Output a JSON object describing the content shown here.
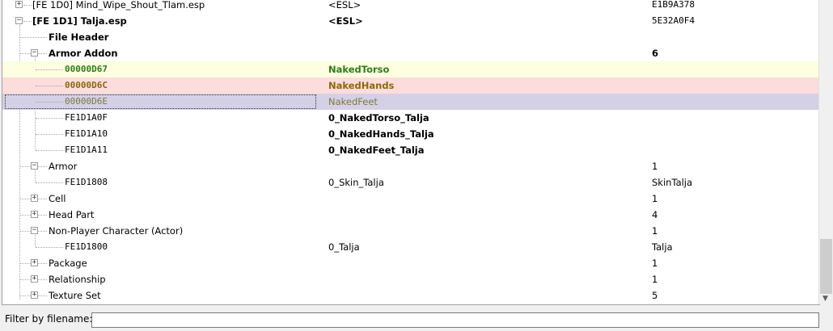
{
  "tree": {
    "rows": [
      {
        "name": "Mind_Wipe_Shout_Tlam.esp",
        "c1": "[FE 1D0] Mind_Wipe_Shout_Tlam.esp",
        "c2": "<ESL>",
        "c3": "E1B9A378"
      },
      {
        "name": "Talja.esp",
        "c1": "[FE 1D1] Talja.esp",
        "c2": "<ESL>",
        "c3": "5E32A0F4"
      },
      {
        "name": "File Header",
        "c1": "File Header",
        "c2": "",
        "c3": ""
      },
      {
        "name": "Armor Addon",
        "c1": "Armor Addon",
        "c2": "",
        "c3": "6"
      },
      {
        "name": "00000D67",
        "c1": "00000D67",
        "c2": "NakedTorso",
        "c3": ""
      },
      {
        "name": "00000D6C",
        "c1": "00000D6C",
        "c2": "NakedHands",
        "c3": ""
      },
      {
        "name": "00000D6E",
        "c1": "00000D6E",
        "c2": "NakedFeet",
        "c3": ""
      },
      {
        "name": "FE1D1A0F",
        "c1": "FE1D1A0F",
        "c2": "0_NakedTorso_Talja",
        "c3": ""
      },
      {
        "name": "FE1D1A10",
        "c1": "FE1D1A10",
        "c2": "0_NakedHands_Talja",
        "c3": ""
      },
      {
        "name": "FE1D1A11",
        "c1": "FE1D1A11",
        "c2": "0_NakedFeet_Talja",
        "c3": ""
      },
      {
        "name": "Armor",
        "c1": "Armor",
        "c2": "",
        "c3": "1"
      },
      {
        "name": "FE1D1808",
        "c1": "FE1D1808",
        "c2": "0_Skin_Talja",
        "c3": "SkinTalja"
      },
      {
        "name": "Cell",
        "c1": "Cell",
        "c2": "",
        "c3": "1"
      },
      {
        "name": "Head Part",
        "c1": "Head Part",
        "c2": "",
        "c3": "4"
      },
      {
        "name": "Non-Player Character (Actor)",
        "c1": "Non-Player Character (Actor)",
        "c2": "",
        "c3": "1"
      },
      {
        "name": "FE1D1800",
        "c1": "FE1D1800",
        "c2": "0_Talja",
        "c3": "Talja"
      },
      {
        "name": "Package",
        "c1": "Package",
        "c2": "",
        "c3": "1"
      },
      {
        "name": "Relationship",
        "c1": "Relationship",
        "c2": "",
        "c3": "1"
      },
      {
        "name": "Texture Set",
        "c1": "Texture Set",
        "c2": "",
        "c3": "5"
      }
    ]
  },
  "filter": {
    "label": "Filter by filename:",
    "value": ""
  },
  "colors": {
    "override_yellow": "#fefee0",
    "conflict_red": "#fddcdc",
    "selected": "#d4d0e6",
    "green_text": "#2e7d1b",
    "olive_text": "#8a6a0a"
  }
}
